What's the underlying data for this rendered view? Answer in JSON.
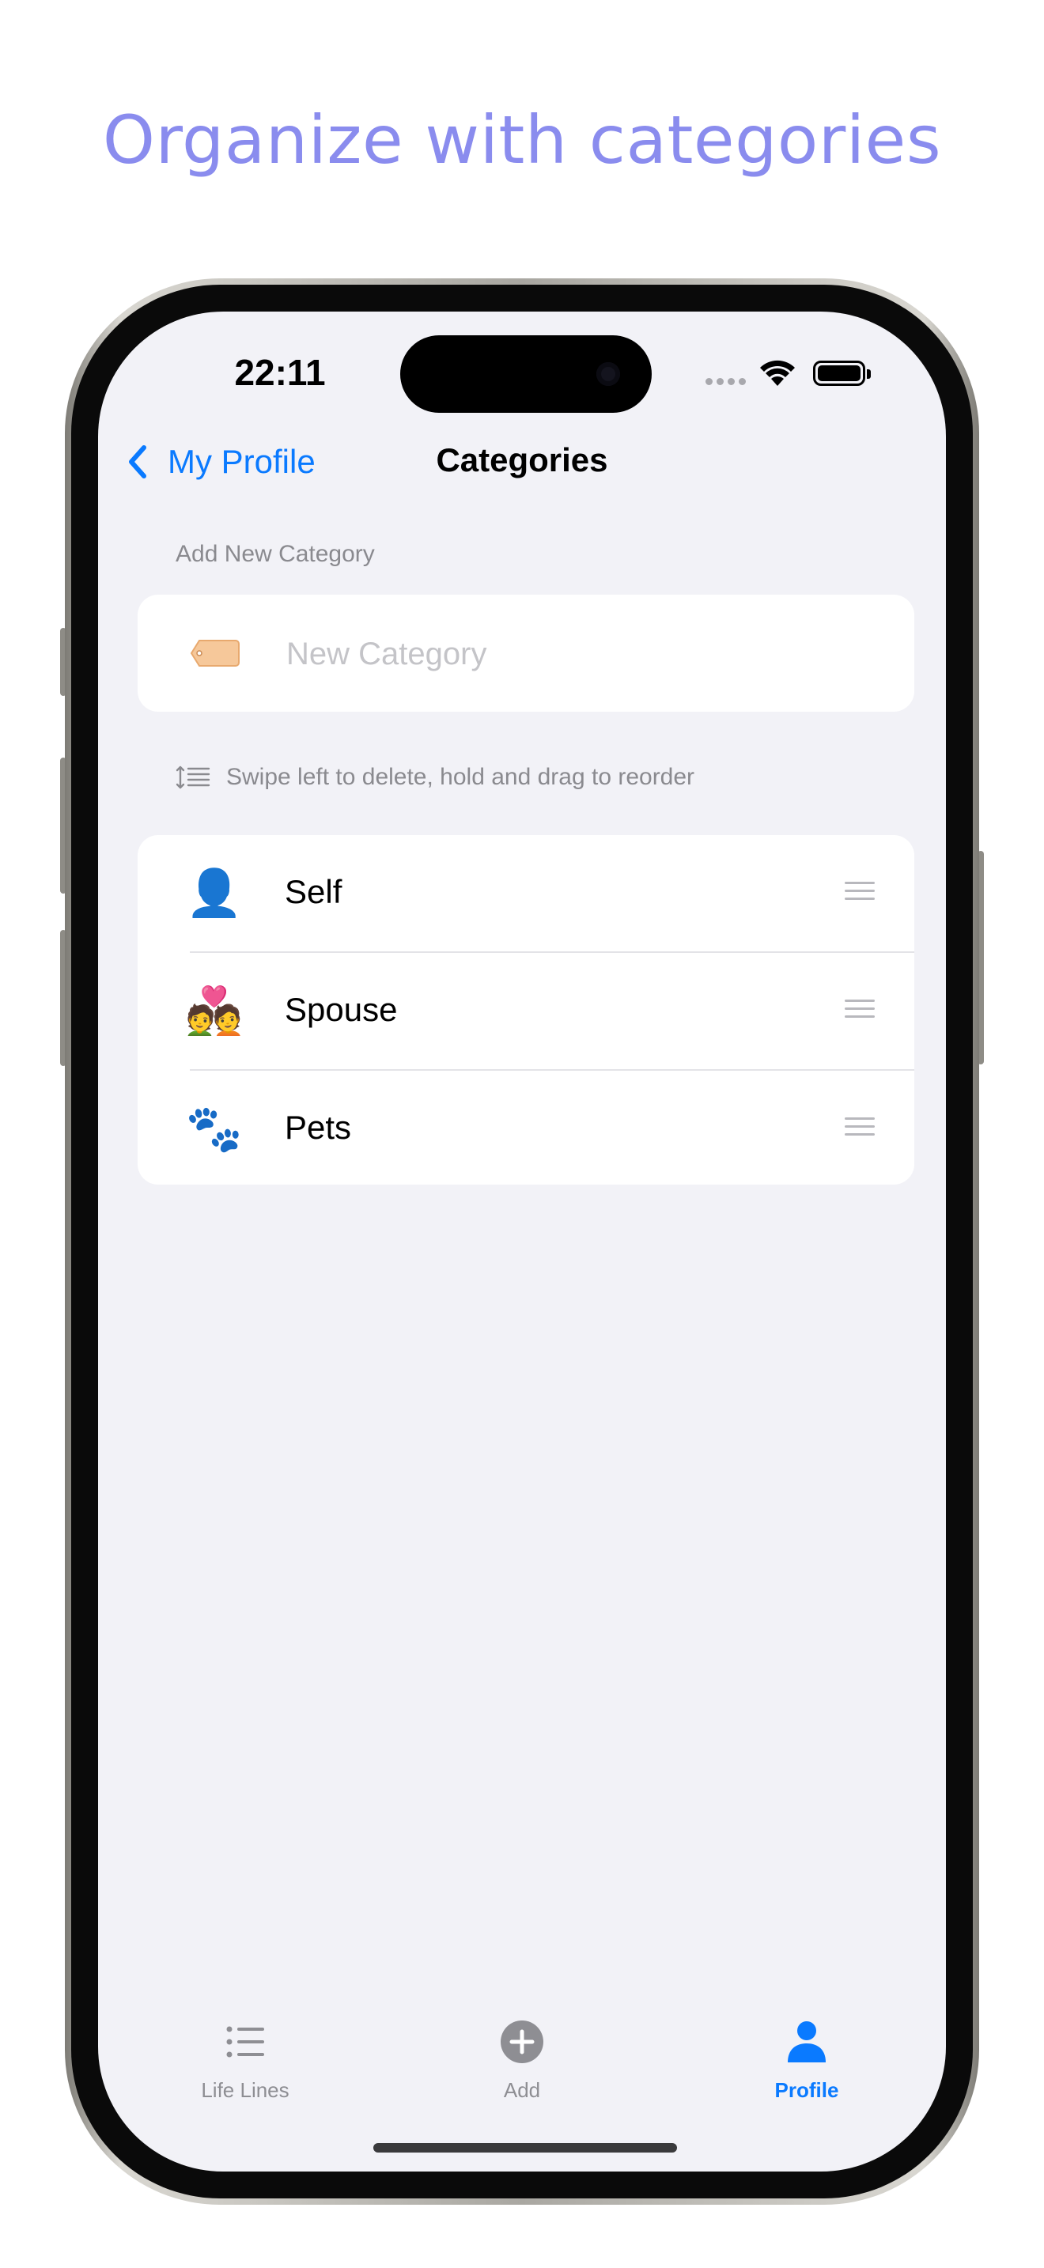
{
  "headline": "Organize with categories",
  "status_bar": {
    "time": "22:11"
  },
  "nav": {
    "back_label": "My Profile",
    "title": "Categories"
  },
  "add_section": {
    "label": "Add New Category",
    "input_placeholder": "New Category",
    "input_value": "",
    "icon": "tag-icon"
  },
  "hint": {
    "icon": "reorder-icon",
    "text": "Swipe left to delete, hold and drag to reorder"
  },
  "categories": [
    {
      "emoji": "👤",
      "name": "Self"
    },
    {
      "emoji": "💑",
      "name": "Spouse"
    },
    {
      "emoji": "🐾",
      "name": "Pets"
    }
  ],
  "tabbar": {
    "items": [
      {
        "label": "Life Lines",
        "icon": "list-icon",
        "active": false
      },
      {
        "label": "Add",
        "icon": "plus-circle-icon",
        "active": false
      },
      {
        "label": "Profile",
        "icon": "person-icon",
        "active": true
      }
    ]
  },
  "colors": {
    "accent": "#0a7aff",
    "headline": "#8a8cee",
    "inactive": "#8e8e93",
    "background": "#f2f2f7"
  }
}
